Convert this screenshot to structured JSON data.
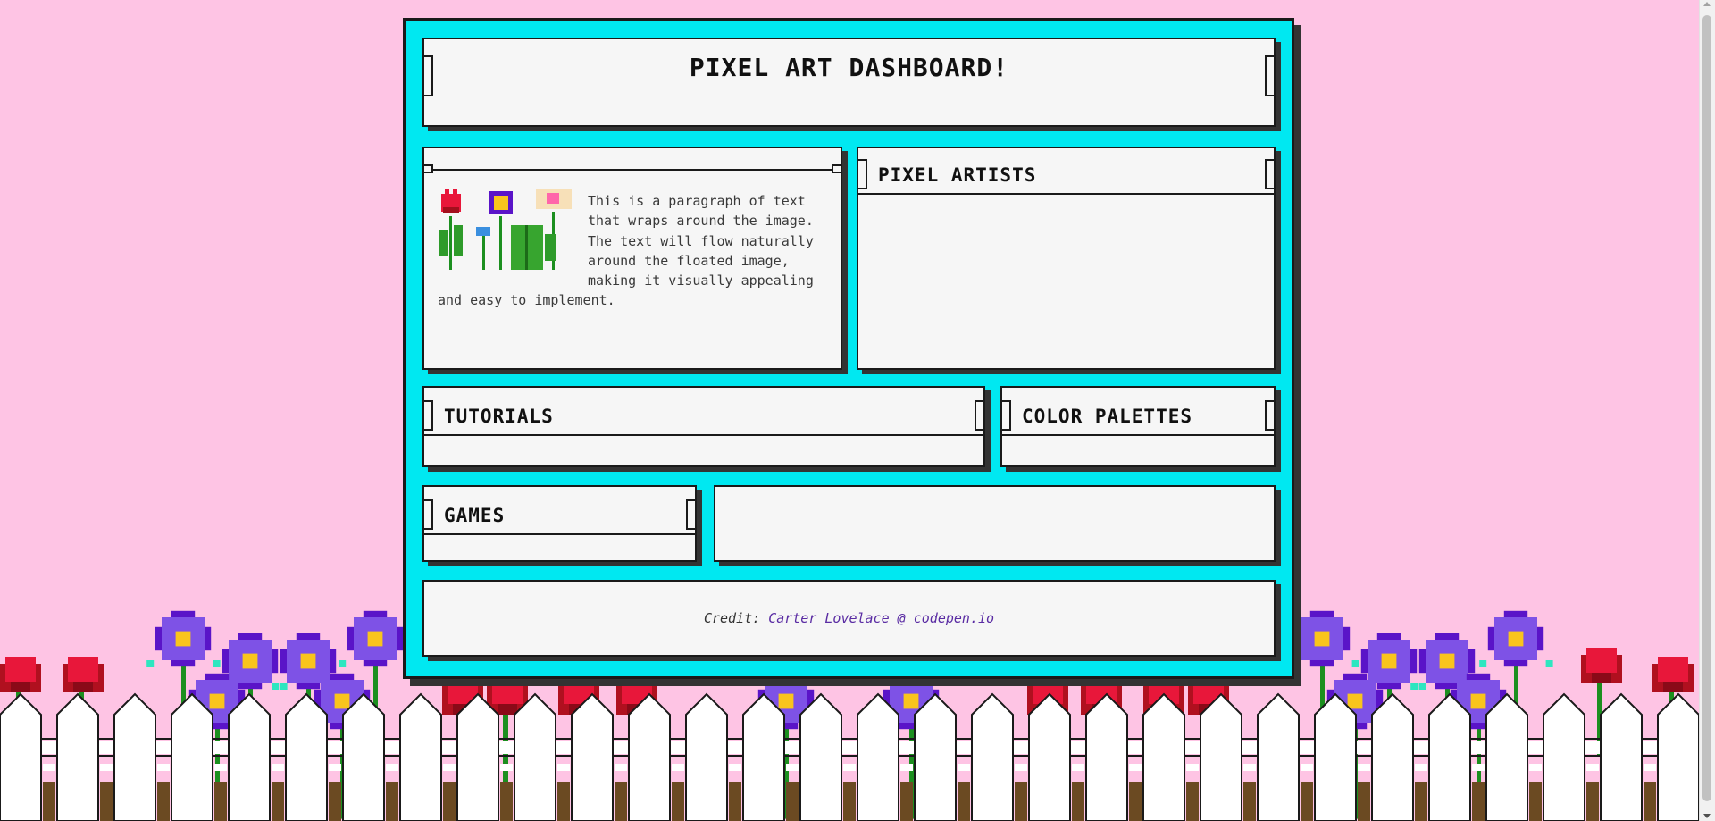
{
  "header": {
    "title": "PIXEL ART DASHBOARD!"
  },
  "intro": {
    "paragraph": "This is a paragraph of text that wraps around the image. The text will flow naturally around the floated image, making it visually appealing and easy to implement.",
    "image_icon": "pixel-flowers-icon"
  },
  "sections": {
    "pixel_artists": "PIXEL ARTISTS",
    "tutorials": "TUTORIALS",
    "color_palettes": "COLOR PALETTES",
    "games": "GAMES"
  },
  "footer": {
    "credit_label": "Credit:",
    "credit_link": "Carter Lovelace @ codepen.io"
  },
  "colors": {
    "background": "#fec4e4",
    "frame": "#00e8f1",
    "panel": "#f6f6f6",
    "border": "#1a1a1a",
    "rose": "#e8173a",
    "violet": "#5a14c8",
    "petal": "#7e52e6",
    "center": "#f9c51d",
    "stem": "#1c8f1f",
    "fence": "#ffffff"
  }
}
